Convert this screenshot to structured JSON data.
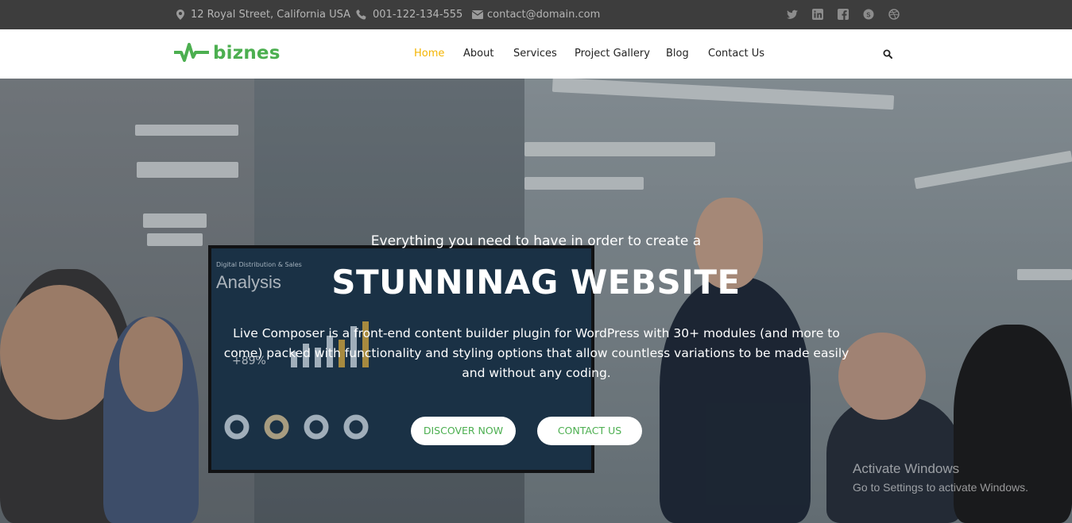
{
  "topbar": {
    "address": "12 Royal Street, California USA",
    "phone": "001-122-134-555",
    "email": "contact@domain.com",
    "social_icons": [
      "twitter-icon",
      "linkedin-icon",
      "facebook-icon",
      "skype-icon",
      "dribbble-icon"
    ]
  },
  "header": {
    "logo_text": "biznes",
    "nav": [
      {
        "label": "Home",
        "active": true
      },
      {
        "label": "About"
      },
      {
        "label": "Services"
      },
      {
        "label": "Project Gallery"
      },
      {
        "label": "Blog"
      },
      {
        "label": "Contact Us"
      }
    ]
  },
  "hero": {
    "subtitle": "Everything you need to have in order to create a",
    "title": "STUNNINAG WEBSITE",
    "description": "Live Composer is a front-end content builder plugin for WordPress with 30+ modules (and more to come) packed with functionality and styling options that allow countless variations to be made easily and without any coding.",
    "btn_primary": "DISCOVER NOW",
    "btn_secondary": "CONTACT US",
    "screen_caption": "Digital Distribution & Sales",
    "screen_heading": "Analysis",
    "screen_stat": "+89%"
  },
  "watermark": {
    "line1": "Activate Windows",
    "line2": "Go to Settings to activate Windows."
  },
  "colors": {
    "accent": "#4caf50",
    "nav_active": "#f4b400",
    "topbar_bg": "#3d3d3d"
  }
}
